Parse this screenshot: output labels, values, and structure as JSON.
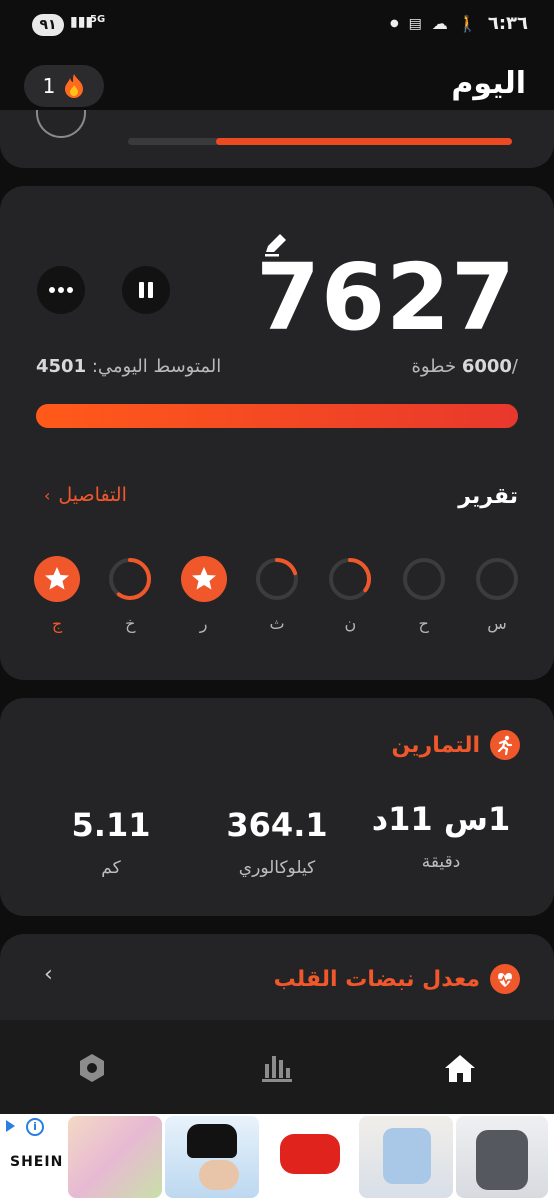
{
  "status_bar": {
    "battery": "٩١",
    "network": "5G",
    "time": "٦:٣٦"
  },
  "header": {
    "title": "اليوم",
    "streak_count": "1"
  },
  "top_card": {
    "progress": 0.77
  },
  "steps": {
    "count": "7627",
    "goal_number": "6000",
    "goal_prefix": "/",
    "goal_unit": "خطوة",
    "average_label": "المتوسط اليومي:",
    "average_value": "4501",
    "progress": 1.0
  },
  "report": {
    "title": "تقرير",
    "details_label": "التفاصيل",
    "days": [
      {
        "label": "س",
        "state": "empty",
        "progress": 0
      },
      {
        "label": "ح",
        "state": "empty",
        "progress": 0
      },
      {
        "label": "ن",
        "state": "partial",
        "progress": 0.35
      },
      {
        "label": "ث",
        "state": "partial",
        "progress": 0.2
      },
      {
        "label": "ر",
        "state": "complete",
        "progress": 1
      },
      {
        "label": "خ",
        "state": "partial",
        "progress": 0.6
      },
      {
        "label": "ج",
        "state": "complete",
        "progress": 1,
        "current": true
      }
    ]
  },
  "exercises": {
    "title": "التمارين",
    "stats": [
      {
        "value": "1س 11د",
        "unit": "دقيقة"
      },
      {
        "value": "364.1",
        "unit": "كيلوكالوري"
      },
      {
        "value": "5.11",
        "unit": "كم"
      }
    ]
  },
  "heart_rate": {
    "title": "معدل نبضات القلب"
  },
  "nav": {
    "items": [
      "home-icon",
      "stats-icon",
      "settings-icon"
    ],
    "active": "home-icon"
  },
  "ad": {
    "brand": "SHEIN"
  },
  "colors": {
    "accent": "#f0582b",
    "card": "#242426",
    "background": "#0e0e0e"
  }
}
